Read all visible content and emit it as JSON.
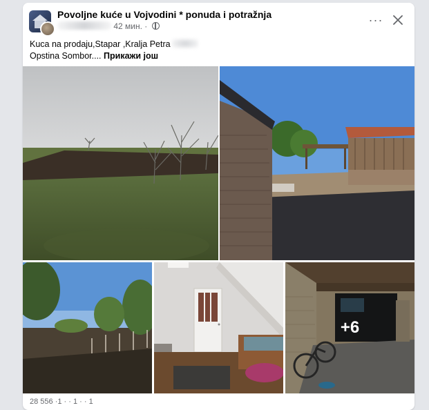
{
  "post": {
    "group_name": "Povoljne kuće u Vojvodini * ponuda i potražnja",
    "time": "42 мин. ·",
    "text_line1": "Kuca na prodaju,Stapar ,Kralja Petra",
    "text_line2": "Opstina Sombor....",
    "see_more": "Прикажи још",
    "more_count": "+6",
    "footer_partial": "28 556 ·1 · · 1 · · 1"
  },
  "icons": {
    "more": "more-horizontal-icon",
    "close": "close-icon",
    "privacy": "globe-icon"
  },
  "colors": {
    "card_bg": "#ffffff",
    "page_bg": "#e4e6ea",
    "text": "#050505",
    "secondary_text": "#65676b"
  }
}
